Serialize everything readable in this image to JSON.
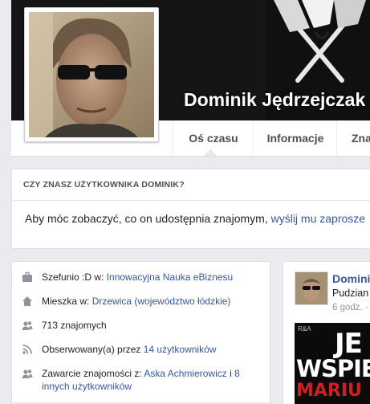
{
  "profile": {
    "name": "Dominik Jędrzejczak"
  },
  "nav": {
    "tabs": [
      {
        "label": "Oś czasu",
        "active": true
      },
      {
        "label": "Informacje"
      },
      {
        "label": "Zna"
      }
    ]
  },
  "friend_box": {
    "header": "CZY ZNASZ UŻYTKOWNIKA DOMINIK?",
    "text": "Aby móc zobaczyć, co on udostępnia znajomym, ",
    "link": "wyślij mu zaprosze"
  },
  "intro": {
    "work_prefix": "Szefunio :D w: ",
    "work_link": "Innowacyjna Nauka eBiznesu",
    "lives_prefix": "Mieszka w: ",
    "lives_link": "Drzewica (województwo łódzkie)",
    "friends": "713 znajomych",
    "followed_prefix": "Obserwowany(a) przez ",
    "followed_link": "14 użytkowników",
    "mutual_prefix": "Zawarcie znajomości z: ",
    "mutual_link1": "Aska Achmierowicz",
    "mutual_sep": " i ",
    "mutual_link2": "8 innych użytkowników"
  },
  "post": {
    "author": "Domini",
    "subtitle": "Pudzian",
    "time": "6 godz. ·",
    "media_tag": "R&A",
    "media_line1": "JE",
    "media_line2": "WSPIE",
    "media_line3": "MARIU"
  },
  "colors": {
    "link": "#365899",
    "background": "#e9ebee",
    "cover": "#151515"
  }
}
